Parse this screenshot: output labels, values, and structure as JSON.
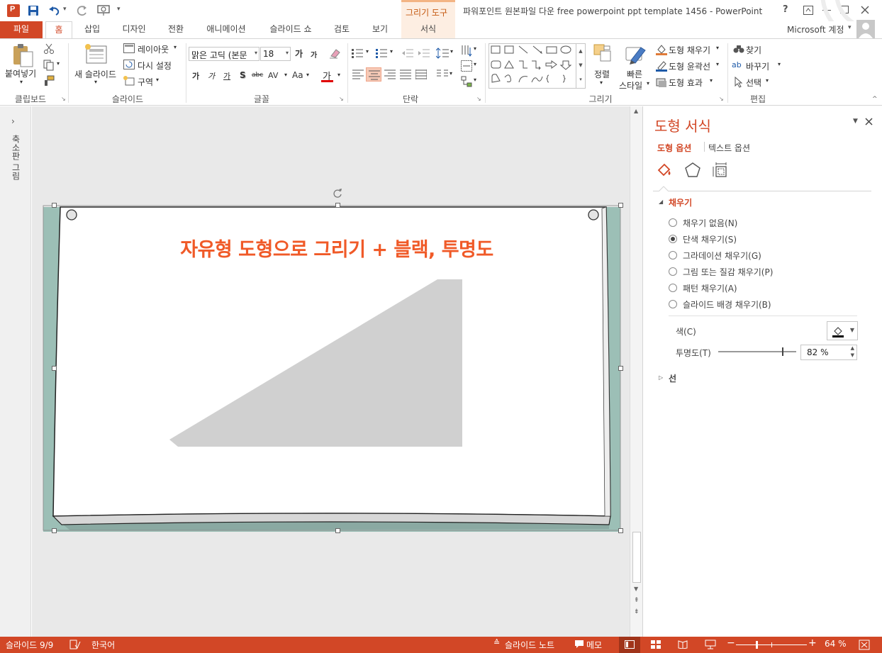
{
  "titlebar": {
    "contextual_group": "그리기 도구",
    "window_title": "파워포인트 원본파일 다운 free powerpoint ppt template 1456 - PowerPoint",
    "help": "?"
  },
  "tabs": [
    {
      "label": "파일"
    },
    {
      "label": "홈"
    },
    {
      "label": "삽입"
    },
    {
      "label": "디자인"
    },
    {
      "label": "전환"
    },
    {
      "label": "애니메이션"
    },
    {
      "label": "슬라이드 쇼"
    },
    {
      "label": "검토"
    },
    {
      "label": "보기"
    },
    {
      "label": "서식"
    }
  ],
  "account": "Microsoft 계정",
  "ribbon": {
    "clipboard": {
      "paste": "붙여넣기",
      "group": "클립보드"
    },
    "slides": {
      "new_slide": "새 슬라이드",
      "layout": "레이아웃",
      "reset": "다시 설정",
      "section": "구역",
      "group": "슬라이드"
    },
    "font": {
      "font_name": "맑은 고딕 (본문",
      "font_size": "18",
      "group": "글꼴",
      "grow": "가",
      "shrink": "가",
      "bold": "가",
      "italic": "가",
      "underline": "가",
      "shadow": "S",
      "strike": "abc",
      "spacing": "AV",
      "case": "Aa",
      "color": "가"
    },
    "paragraph": {
      "group": "단락"
    },
    "drawing": {
      "arrange": "정렬",
      "quick_styles": "빠른",
      "quick_styles2": "스타일",
      "fill": "도형 채우기",
      "outline": "도형 윤곽선",
      "effects": "도형 효과",
      "group": "그리기"
    },
    "editing": {
      "find": "찾기",
      "replace": "바꾸기",
      "select": "선택",
      "group": "편집"
    }
  },
  "left_panel": {
    "label": "축소판 그림"
  },
  "slide": {
    "title": "자유형 도형으로 그리기 + 블랙, 투명도",
    "title_color": "#f05a28",
    "shape_color": "#d0d0d0"
  },
  "format_pane": {
    "title": "도형 서식",
    "tab_shape": "도형 옵션",
    "tab_text": "텍스트 옵션",
    "fill_section": "채우기",
    "options": [
      {
        "label": "채우기 없음(N)",
        "selected": false
      },
      {
        "label": "단색 채우기(S)",
        "selected": true
      },
      {
        "label": "그라데이션 채우기(G)",
        "selected": false
      },
      {
        "label": "그림 또는 질감 채우기(P)",
        "selected": false
      },
      {
        "label": "패턴 채우기(A)",
        "selected": false
      },
      {
        "label": "슬라이드 배경 채우기(B)",
        "selected": false
      }
    ],
    "color_label": "색(C)",
    "transparency_label": "투명도(T)",
    "transparency_value": "82 %",
    "transparency_level": 0.82,
    "line_section": "선"
  },
  "statusbar": {
    "slide_info": "슬라이드 9/9",
    "language": "한국어",
    "notes": "슬라이드 노트",
    "comments": "메모",
    "zoom": "64 %",
    "color": "#d24726"
  },
  "colors": {
    "accent": "#d24726",
    "contextual": "#f3b484"
  }
}
